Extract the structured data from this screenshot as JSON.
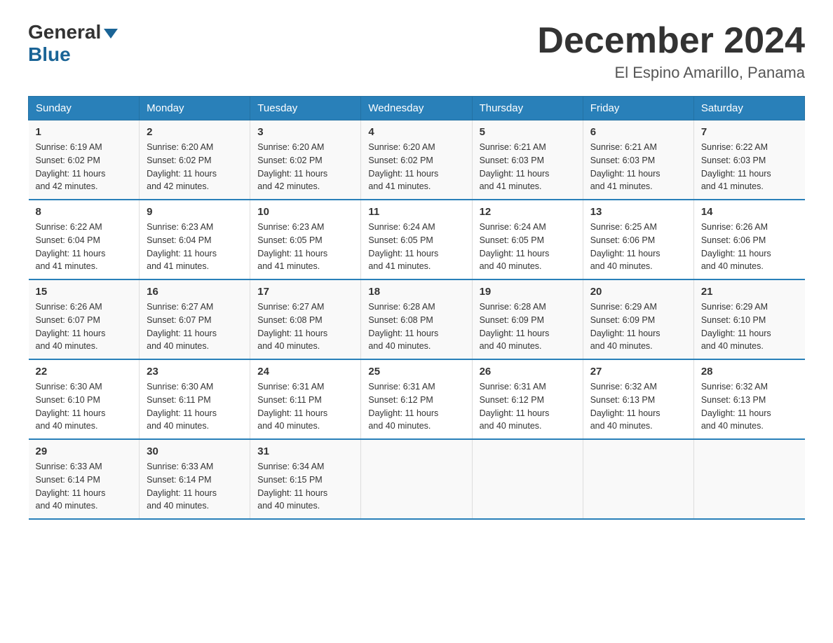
{
  "logo": {
    "general": "General",
    "blue": "Blue"
  },
  "header": {
    "month_year": "December 2024",
    "location": "El Espino Amarillo, Panama"
  },
  "weekdays": [
    "Sunday",
    "Monday",
    "Tuesday",
    "Wednesday",
    "Thursday",
    "Friday",
    "Saturday"
  ],
  "weeks": [
    [
      {
        "day": "1",
        "sunrise": "6:19 AM",
        "sunset": "6:02 PM",
        "daylight": "11 hours and 42 minutes."
      },
      {
        "day": "2",
        "sunrise": "6:20 AM",
        "sunset": "6:02 PM",
        "daylight": "11 hours and 42 minutes."
      },
      {
        "day": "3",
        "sunrise": "6:20 AM",
        "sunset": "6:02 PM",
        "daylight": "11 hours and 42 minutes."
      },
      {
        "day": "4",
        "sunrise": "6:20 AM",
        "sunset": "6:02 PM",
        "daylight": "11 hours and 41 minutes."
      },
      {
        "day": "5",
        "sunrise": "6:21 AM",
        "sunset": "6:03 PM",
        "daylight": "11 hours and 41 minutes."
      },
      {
        "day": "6",
        "sunrise": "6:21 AM",
        "sunset": "6:03 PM",
        "daylight": "11 hours and 41 minutes."
      },
      {
        "day": "7",
        "sunrise": "6:22 AM",
        "sunset": "6:03 PM",
        "daylight": "11 hours and 41 minutes."
      }
    ],
    [
      {
        "day": "8",
        "sunrise": "6:22 AM",
        "sunset": "6:04 PM",
        "daylight": "11 hours and 41 minutes."
      },
      {
        "day": "9",
        "sunrise": "6:23 AM",
        "sunset": "6:04 PM",
        "daylight": "11 hours and 41 minutes."
      },
      {
        "day": "10",
        "sunrise": "6:23 AM",
        "sunset": "6:05 PM",
        "daylight": "11 hours and 41 minutes."
      },
      {
        "day": "11",
        "sunrise": "6:24 AM",
        "sunset": "6:05 PM",
        "daylight": "11 hours and 41 minutes."
      },
      {
        "day": "12",
        "sunrise": "6:24 AM",
        "sunset": "6:05 PM",
        "daylight": "11 hours and 40 minutes."
      },
      {
        "day": "13",
        "sunrise": "6:25 AM",
        "sunset": "6:06 PM",
        "daylight": "11 hours and 40 minutes."
      },
      {
        "day": "14",
        "sunrise": "6:26 AM",
        "sunset": "6:06 PM",
        "daylight": "11 hours and 40 minutes."
      }
    ],
    [
      {
        "day": "15",
        "sunrise": "6:26 AM",
        "sunset": "6:07 PM",
        "daylight": "11 hours and 40 minutes."
      },
      {
        "day": "16",
        "sunrise": "6:27 AM",
        "sunset": "6:07 PM",
        "daylight": "11 hours and 40 minutes."
      },
      {
        "day": "17",
        "sunrise": "6:27 AM",
        "sunset": "6:08 PM",
        "daylight": "11 hours and 40 minutes."
      },
      {
        "day": "18",
        "sunrise": "6:28 AM",
        "sunset": "6:08 PM",
        "daylight": "11 hours and 40 minutes."
      },
      {
        "day": "19",
        "sunrise": "6:28 AM",
        "sunset": "6:09 PM",
        "daylight": "11 hours and 40 minutes."
      },
      {
        "day": "20",
        "sunrise": "6:29 AM",
        "sunset": "6:09 PM",
        "daylight": "11 hours and 40 minutes."
      },
      {
        "day": "21",
        "sunrise": "6:29 AM",
        "sunset": "6:10 PM",
        "daylight": "11 hours and 40 minutes."
      }
    ],
    [
      {
        "day": "22",
        "sunrise": "6:30 AM",
        "sunset": "6:10 PM",
        "daylight": "11 hours and 40 minutes."
      },
      {
        "day": "23",
        "sunrise": "6:30 AM",
        "sunset": "6:11 PM",
        "daylight": "11 hours and 40 minutes."
      },
      {
        "day": "24",
        "sunrise": "6:31 AM",
        "sunset": "6:11 PM",
        "daylight": "11 hours and 40 minutes."
      },
      {
        "day": "25",
        "sunrise": "6:31 AM",
        "sunset": "6:12 PM",
        "daylight": "11 hours and 40 minutes."
      },
      {
        "day": "26",
        "sunrise": "6:31 AM",
        "sunset": "6:12 PM",
        "daylight": "11 hours and 40 minutes."
      },
      {
        "day": "27",
        "sunrise": "6:32 AM",
        "sunset": "6:13 PM",
        "daylight": "11 hours and 40 minutes."
      },
      {
        "day": "28",
        "sunrise": "6:32 AM",
        "sunset": "6:13 PM",
        "daylight": "11 hours and 40 minutes."
      }
    ],
    [
      {
        "day": "29",
        "sunrise": "6:33 AM",
        "sunset": "6:14 PM",
        "daylight": "11 hours and 40 minutes."
      },
      {
        "day": "30",
        "sunrise": "6:33 AM",
        "sunset": "6:14 PM",
        "daylight": "11 hours and 40 minutes."
      },
      {
        "day": "31",
        "sunrise": "6:34 AM",
        "sunset": "6:15 PM",
        "daylight": "11 hours and 40 minutes."
      },
      null,
      null,
      null,
      null
    ]
  ],
  "labels": {
    "sunrise": "Sunrise:",
    "sunset": "Sunset:",
    "daylight": "Daylight:"
  }
}
